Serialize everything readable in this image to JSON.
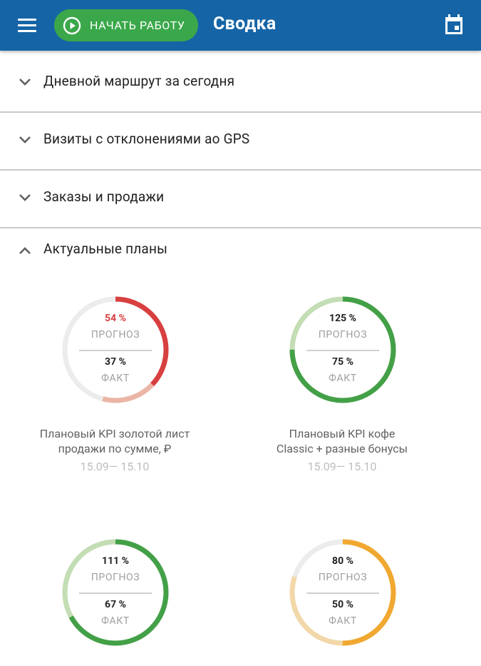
{
  "colors": {
    "appbar": "#1565a6",
    "start_button": "#3aa84a",
    "red": "#d84040",
    "green": "#43a047",
    "orange": "#f0a830"
  },
  "appbar": {
    "menu_icon": "hamburger-menu-icon",
    "start_button": {
      "icon": "play-circle-icon",
      "label": "НАЧАТЬ РАБОТУ"
    },
    "title": "Сводка",
    "calendar_icon": "calendar-icon"
  },
  "sections": [
    {
      "title": "Дневной маршрут за сегодня",
      "expanded": false
    },
    {
      "title": "Визиты с отклонениями ао GPS",
      "expanded": false
    },
    {
      "title": "Заказы и продажи",
      "expanded": false
    },
    {
      "title": "Актуальные планы",
      "expanded": true
    }
  ],
  "plans": [
    {
      "forecast": "54 %",
      "forecast_label": "ПРОГНОЗ",
      "fact": "37 %",
      "fact_label": "ФАКТ",
      "name_line1": "Плановый KPI золотой лист",
      "name_line2": "продажи по сумме, ₽",
      "period": "15.09— 15.10",
      "forecast_value": 0.54,
      "fact_value": 0.37,
      "color": "#d84040",
      "light_color": "#ebb5a6",
      "forecast_color": "#d84040"
    },
    {
      "forecast": "125 %",
      "forecast_label": "ПРОГНОЗ",
      "fact": "75 %",
      "fact_label": "ФАКТ",
      "name_line1": "Плановый KPI кофе",
      "name_line2": "Classic + разные бонусы",
      "period": "15.09— 15.10",
      "forecast_value": 1.25,
      "fact_value": 0.75,
      "color": "#43a047",
      "light_color": "#c3ddb4",
      "forecast_color": "#212121"
    },
    {
      "forecast": "111 %",
      "forecast_label": "ПРОГНОЗ",
      "fact": "67 %",
      "fact_label": "ФАКТ",
      "name_line1": "",
      "name_line2": "",
      "period": "",
      "forecast_value": 1.11,
      "fact_value": 0.67,
      "color": "#43a047",
      "light_color": "#c3ddb4",
      "forecast_color": "#212121"
    },
    {
      "forecast": "80 %",
      "forecast_label": "ПРОГНОЗ",
      "fact": "50 %",
      "fact_label": "ФАКТ",
      "name_line1": "",
      "name_line2": "",
      "period": "",
      "forecast_value": 0.8,
      "fact_value": 0.5,
      "color": "#f0a830",
      "light_color": "#f2d7a8",
      "forecast_color": "#212121"
    }
  ]
}
